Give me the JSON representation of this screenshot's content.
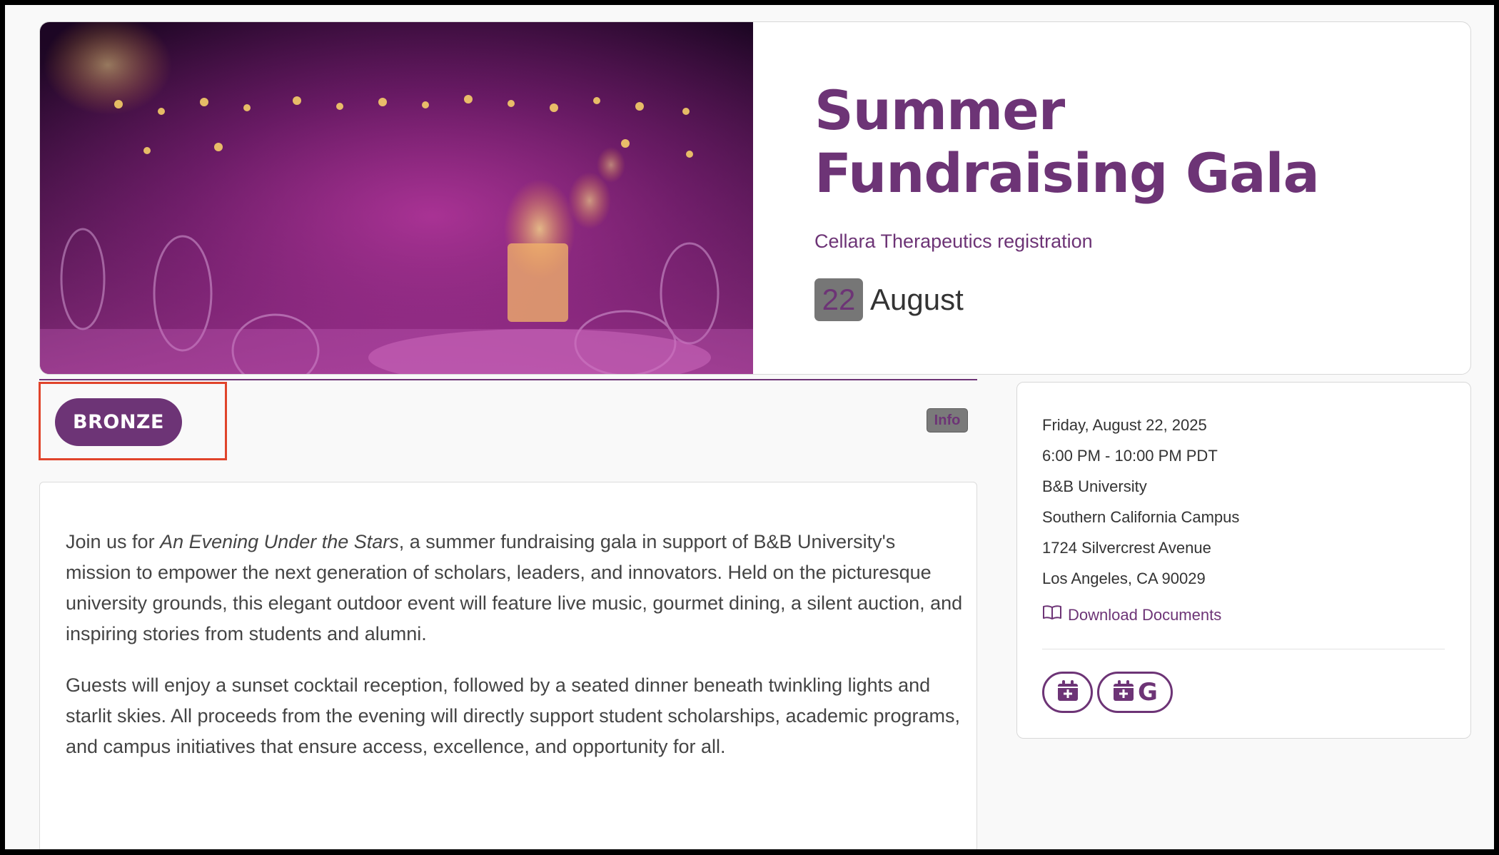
{
  "event": {
    "title": "Summer Fundraising Gala",
    "registration": "Cellara Therapeutics registration",
    "day": "22",
    "month": "August"
  },
  "tier": {
    "label": "BRONZE",
    "info_badge": "Info"
  },
  "description": {
    "p1_lead": "Join us for ",
    "p1_emphasis": "An Evening Under the Stars",
    "p1_rest": ", a summer fundraising gala in support of B&B University's mission to empower the next generation of scholars, leaders, and innovators. Held on the picturesque university grounds, this elegant outdoor event will feature live music, gourmet dining, a silent auction, and inspiring stories from students and alumni.",
    "p2": "Guests will enjoy a sunset cocktail reception, followed by a seated dinner beneath twinkling lights and starlit skies. All proceeds from the evening will directly support student scholarships, academic programs, and campus initiatives that ensure access, excellence, and opportunity for all."
  },
  "details": {
    "date": "Friday, August 22, 2025",
    "time": "6:00 PM - 10:00 PM PDT",
    "venue": "B&B University",
    "campus": "Southern California Campus",
    "street": "1724 Silvercrest Avenue",
    "city": "Los Angeles, CA 90029",
    "download_label": "Download Documents"
  },
  "icons": {
    "download": "book-icon",
    "add_calendar": "calendar-plus-icon",
    "google_calendar": "google-calendar-icon"
  },
  "colors": {
    "brand": "#6d3476",
    "highlight": "#e0442b"
  }
}
